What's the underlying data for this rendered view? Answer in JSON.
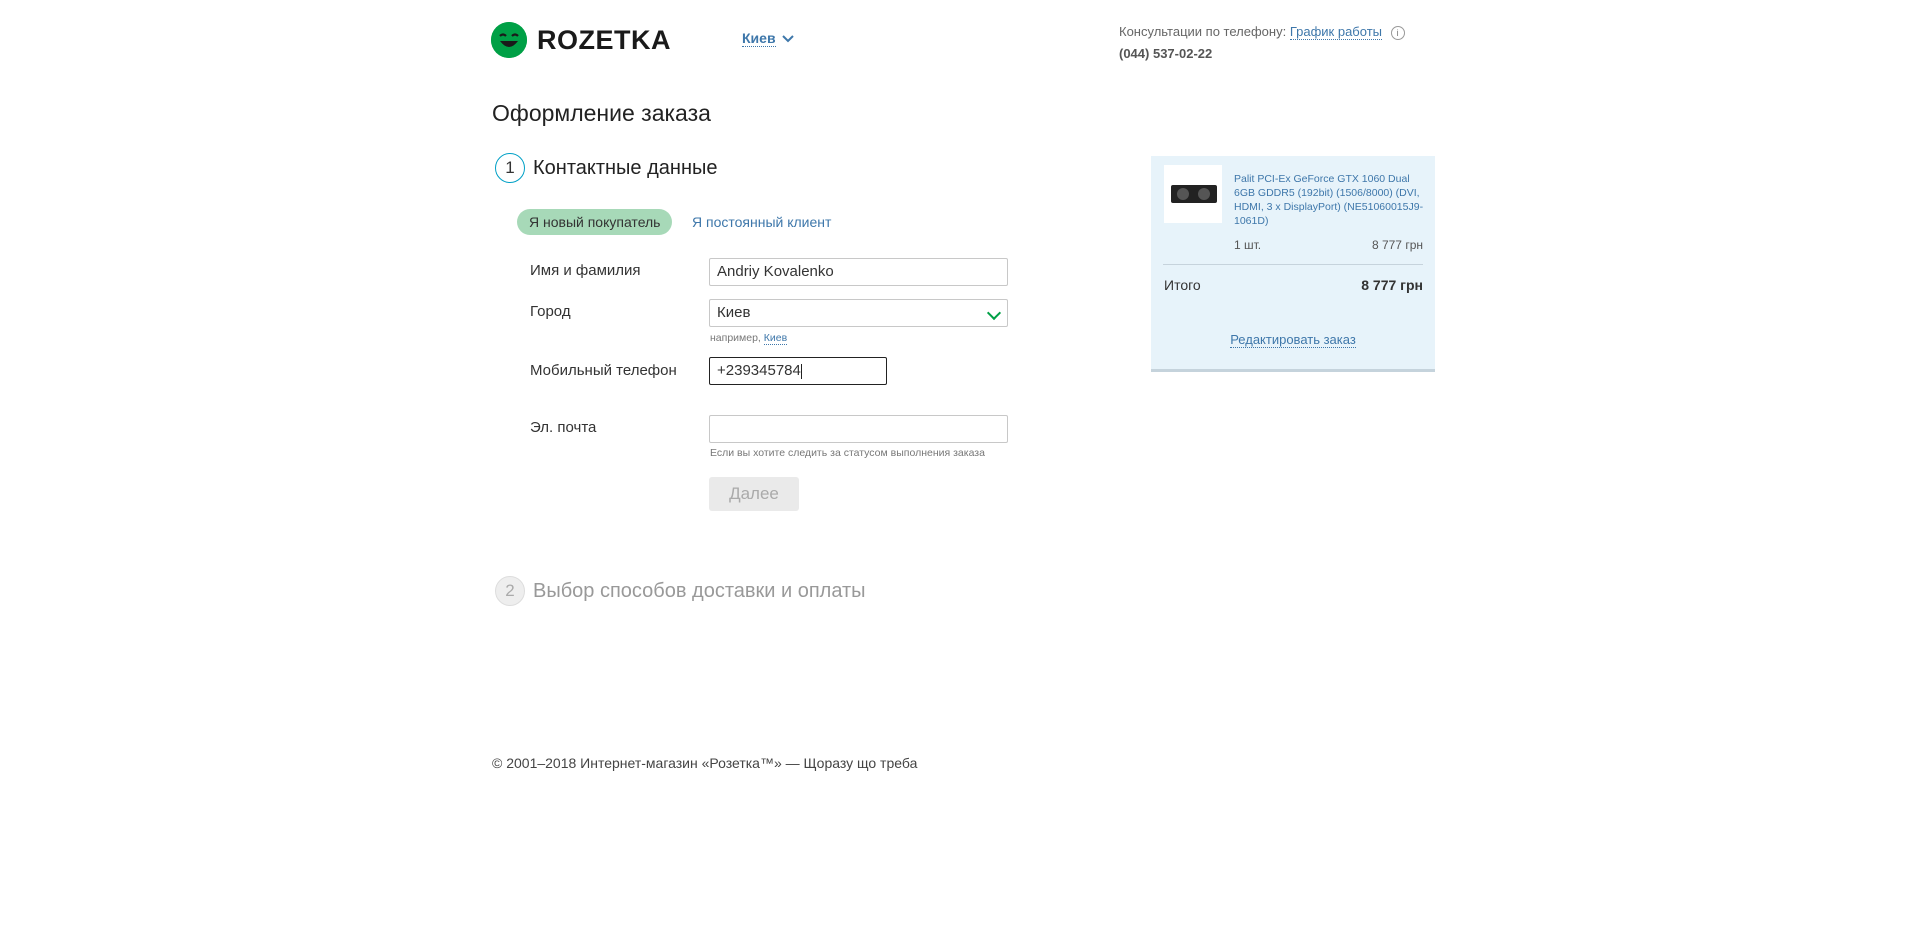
{
  "header": {
    "logo_text": "ROZETKA",
    "city": "Киев",
    "consult_text": "Консультации по телефону:",
    "schedule_link": "График работы",
    "info_icon_glyph": "i",
    "phone": "(044) 537-02-22"
  },
  "page_title": "Оформление заказа",
  "steps": [
    {
      "number": "1",
      "label": "Контактные данные"
    },
    {
      "number": "2",
      "label": "Выбор способов доставки и оплаты"
    }
  ],
  "tabs": {
    "new_buyer": "Я новый покупатель",
    "returning": "Я постоянный клиент"
  },
  "form": {
    "name_label": "Имя и фамилия",
    "name_value": "Andriy Kovalenko",
    "city_label": "Город",
    "city_value": "Киев",
    "city_hint_prefix": "например,",
    "city_hint_link": "Киев",
    "phone_label": "Мобильный телефон",
    "phone_value": "+239345784",
    "email_label": "Эл. почта",
    "email_value": "",
    "email_hint": "Если вы хотите следить за статусом выполнения заказа",
    "next_button": "Далее"
  },
  "cart": {
    "product_name": "Palit PCI-Ex GeForce GTX 1060 Dual 6GB GDDR5 (192bit) (1506/8000) (DVI, HDMI, 3 x DisplayPort) (NE51060015J9-1061D)",
    "quantity": "1 шт.",
    "price": "8 777 грн",
    "total_label": "Итого",
    "total_value": "8 777 грн",
    "edit_link": "Редактировать заказ"
  },
  "footer": "© 2001–2018 Интернет-магазин «Розетка™» — Щоразу що треба",
  "colors": {
    "brand_green": "#00a046",
    "link_blue": "#3e77aa",
    "tab_active_bg": "#a7d9b8",
    "cart_bg": "#e7f3fa"
  }
}
